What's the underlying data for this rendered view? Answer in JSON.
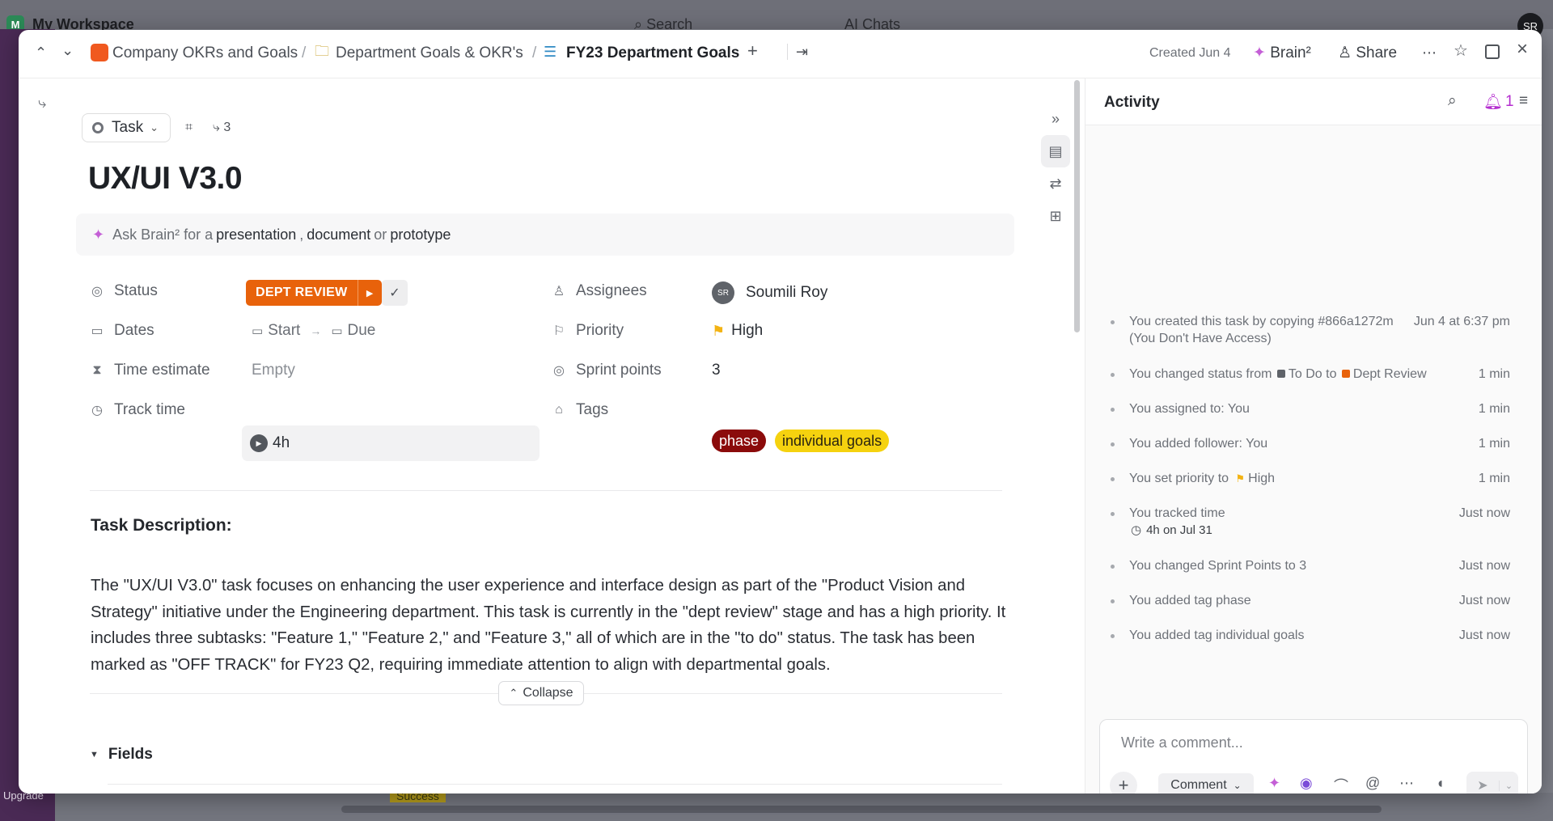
{
  "background": {
    "workspace_badge": "M",
    "workspace_name": "My Workspace",
    "search_label": "Search",
    "ai_label": "AI Chats",
    "avatar": "SR",
    "upgrade_label": "Upgrade",
    "success_label": "Success"
  },
  "header": {
    "breadcrumbs": [
      "Company OKRs and Goals",
      "Department Goals & OKR's",
      "FY23 Department Goals"
    ],
    "created": "Created Jun 4",
    "brain_label": "Brain²",
    "share_label": "Share",
    "icons": [
      "chevron-up-icon",
      "chevron-down-icon",
      "plus-icon",
      "move-icon",
      "more-icon",
      "star-icon",
      "sidebar-icon",
      "close-icon"
    ]
  },
  "task": {
    "type_label": "Task",
    "subtask_count": "3",
    "title": "UX/UI V3.0",
    "ask": {
      "prefix": "Ask Brain² for a",
      "opt1": "presentation",
      "comma": ",",
      "opt2": "document",
      "or": "or",
      "opt3": "prototype"
    }
  },
  "fields": {
    "status_label": "Status",
    "status_value": "DEPT REVIEW",
    "dates_label": "Dates",
    "dates_start": "Start",
    "dates_due": "Due",
    "time_estimate_label": "Time estimate",
    "time_estimate_value": "Empty",
    "track_time_label": "Track time",
    "track_time_value": "4h",
    "assignees_label": "Assignees",
    "assignee_initials": "SR",
    "assignee_name": "Soumili Roy",
    "priority_label": "Priority",
    "priority_value": "High",
    "sprint_label": "Sprint points",
    "sprint_value": "3",
    "tags_label": "Tags",
    "tags": [
      "phase",
      "individual goals"
    ],
    "colors": {
      "status": "#e8620b",
      "tag_phase": "#8b0b0b",
      "tag_goals": "#f5d20f",
      "flag": "#f3b313"
    }
  },
  "description": {
    "heading": "Task Description:",
    "body": "The \"UX/UI V3.0\" task focuses on enhancing the user experience and interface design as part of the \"Product Vision and Strategy\" initiative under the Engineering department. This task is currently in the \"dept review\" stage and has a high priority. It includes three subtasks: \"Feature 1,\" \"Feature 2,\" and \"Feature 3,\" all of which are in the \"to do\" status. The task has been marked as \"OFF TRACK\" for FY23 Q2, requiring immediate attention to align with departmental goals.",
    "collapse_label": "Collapse",
    "fields_heading": "Fields"
  },
  "activity": {
    "title": "Activity",
    "notif_count": "1",
    "items": [
      {
        "text": "You created this task by copying #866a1272m (You Don't Have Access)",
        "time": "Jun 4 at 6:37 pm"
      },
      {
        "prefix": "You changed status from",
        "from": "To Do",
        "to_word": "to",
        "to": "Dept Review",
        "time": "1 min"
      },
      {
        "text": "You assigned to: You",
        "time": "1 min"
      },
      {
        "text": "You added follower: You",
        "time": "1 min"
      },
      {
        "prefix": "You set priority to",
        "value": "High",
        "time": "1 min"
      },
      {
        "text": "You tracked time",
        "sub": "4h on Jul 31",
        "time": "Just now"
      },
      {
        "text": "You changed Sprint Points to 3",
        "time": "Just now"
      },
      {
        "text": "You added tag phase",
        "time": "Just now"
      },
      {
        "text": "You added tag individual goals",
        "time": "Just now"
      }
    ],
    "comment_placeholder": "Write a comment...",
    "comment_type": "Comment"
  }
}
